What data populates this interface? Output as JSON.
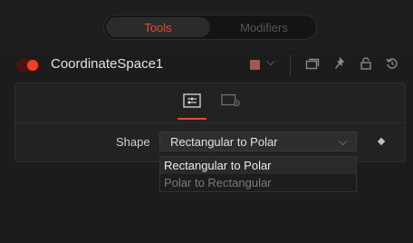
{
  "tabs": [
    {
      "label": "Tools",
      "active": true
    },
    {
      "label": "Modifiers",
      "active": false
    }
  ],
  "node": {
    "name": "CoordinateSpace1",
    "enabled": true,
    "color_swatch": "#a6574e",
    "header_icons": [
      "chevron-down-icon",
      "versions-icon",
      "pin-icon",
      "lock-icon",
      "reset-icon"
    ]
  },
  "panel": {
    "tabs": [
      "controls-icon",
      "settings-icon"
    ],
    "active_tab": "controls-icon"
  },
  "shape": {
    "label": "Shape",
    "selected": "Rectangular to Polar",
    "options": [
      "Rectangular to Polar",
      "Polar to Rectangular"
    ]
  },
  "colors": {
    "accent": "#e84a3a",
    "background": "#1c1c1c"
  }
}
